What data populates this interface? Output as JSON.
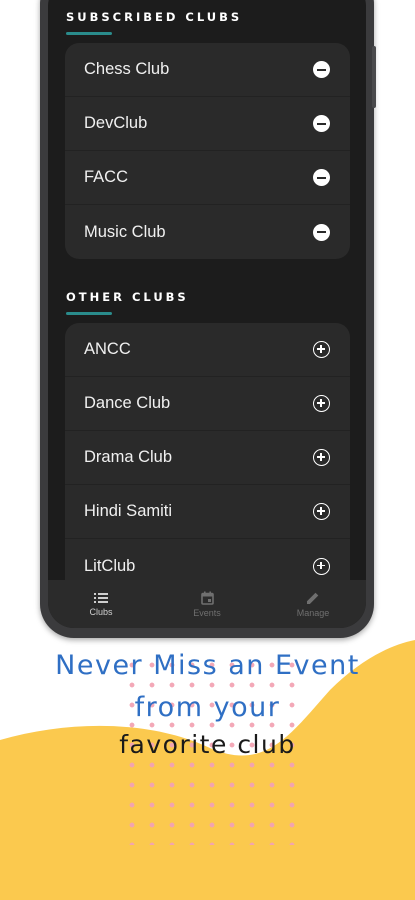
{
  "colors": {
    "accent_teal": "#2a8c8c",
    "headline_blue": "#2f6fc4",
    "wave_yellow": "#fbc94e",
    "dots_pink": "#f2a3b3"
  },
  "subscribed": {
    "title": "SUBSCRIBED CLUBS",
    "items": [
      {
        "name": "Chess Club",
        "icon": "remove-circle-icon"
      },
      {
        "name": "DevClub",
        "icon": "remove-circle-icon"
      },
      {
        "name": "FACC",
        "icon": "remove-circle-icon"
      },
      {
        "name": "Music Club",
        "icon": "remove-circle-icon"
      }
    ]
  },
  "other": {
    "title": "OTHER CLUBS",
    "items": [
      {
        "name": "ANCC",
        "icon": "add-circle-icon"
      },
      {
        "name": "Dance Club",
        "icon": "add-circle-icon"
      },
      {
        "name": "Drama Club",
        "icon": "add-circle-icon"
      },
      {
        "name": "Hindi Samiti",
        "icon": "add-circle-icon"
      },
      {
        "name": "LitClub",
        "icon": "add-circle-icon"
      }
    ]
  },
  "nav": {
    "clubs": {
      "label": "Clubs",
      "icon": "list-icon"
    },
    "events": {
      "label": "Events",
      "icon": "calendar-icon"
    },
    "manage": {
      "label": "Manage",
      "icon": "pencil-icon"
    }
  },
  "tagline": {
    "line1": "Never Miss an Event",
    "line2": "from your",
    "line3": "favorite club"
  }
}
